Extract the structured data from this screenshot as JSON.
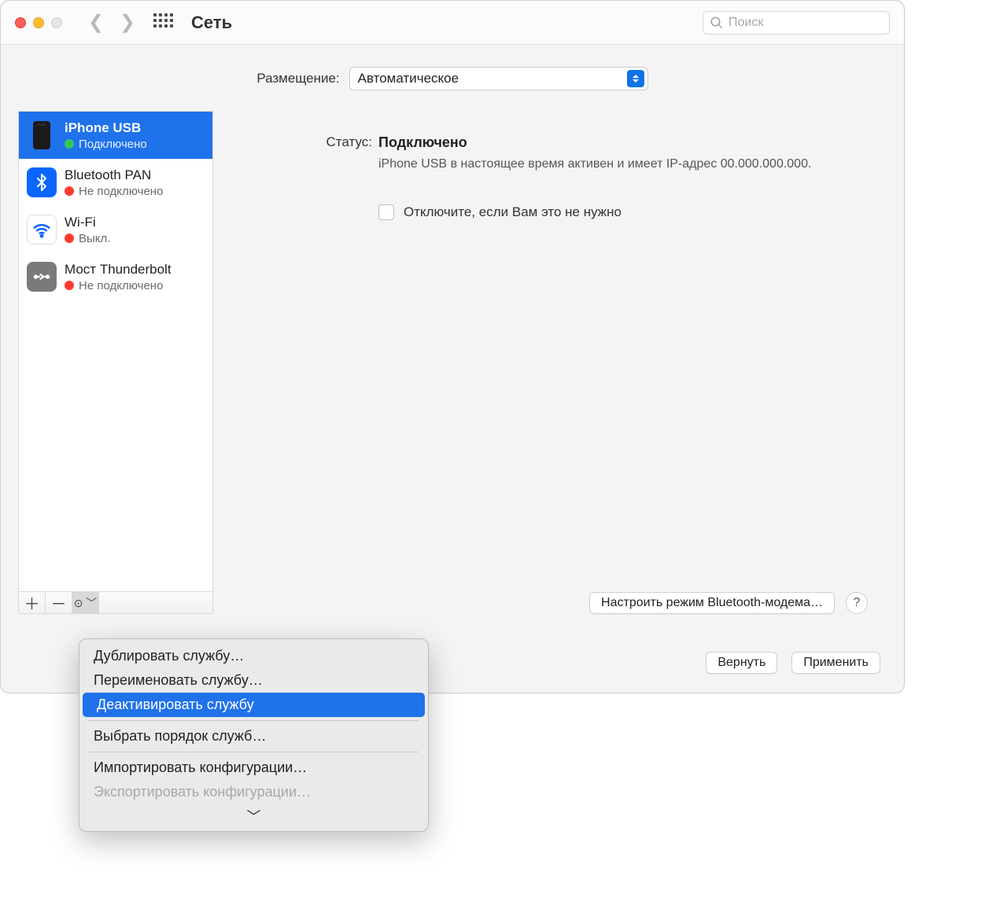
{
  "window": {
    "title": "Сеть"
  },
  "search": {
    "placeholder": "Поиск"
  },
  "location": {
    "label": "Размещение:",
    "value": "Автоматическое"
  },
  "services": [
    {
      "name": "iPhone USB",
      "status": "Подключено",
      "dot": "green",
      "icon": "phone"
    },
    {
      "name": "Bluetooth PAN",
      "status": "Не подключено",
      "dot": "red",
      "icon": "bluetooth"
    },
    {
      "name": "Wi-Fi",
      "status": "Выкл.",
      "dot": "red",
      "icon": "wifi"
    },
    {
      "name": "Мост Thunderbolt",
      "status": "Не подключено",
      "dot": "red",
      "icon": "thunderbolt"
    }
  ],
  "selected_index": 0,
  "detail": {
    "status_label": "Статус:",
    "status_value": "Подключено",
    "status_desc": "iPhone USB в настоящее время активен и имеет IP-адрес 00.000.000.000.",
    "disable_checkbox_label": "Отключите, если Вам это не нужно",
    "configure_button": "Настроить режим Bluetooth-модема…",
    "help": "?"
  },
  "buttons": {
    "revert": "Вернуть",
    "apply": "Применить"
  },
  "popup": {
    "items": [
      {
        "label": "Дублировать службу…",
        "type": "item"
      },
      {
        "label": "Переименовать службу…",
        "type": "item"
      },
      {
        "label": "Деактивировать службу",
        "type": "item",
        "selected": true
      },
      {
        "type": "sep"
      },
      {
        "label": "Выбрать порядок служб…",
        "type": "item"
      },
      {
        "type": "sep"
      },
      {
        "label": "Импортировать конфигурации…",
        "type": "item"
      },
      {
        "label": "Экспортировать конфигурации…",
        "type": "item",
        "disabled": true
      }
    ]
  }
}
